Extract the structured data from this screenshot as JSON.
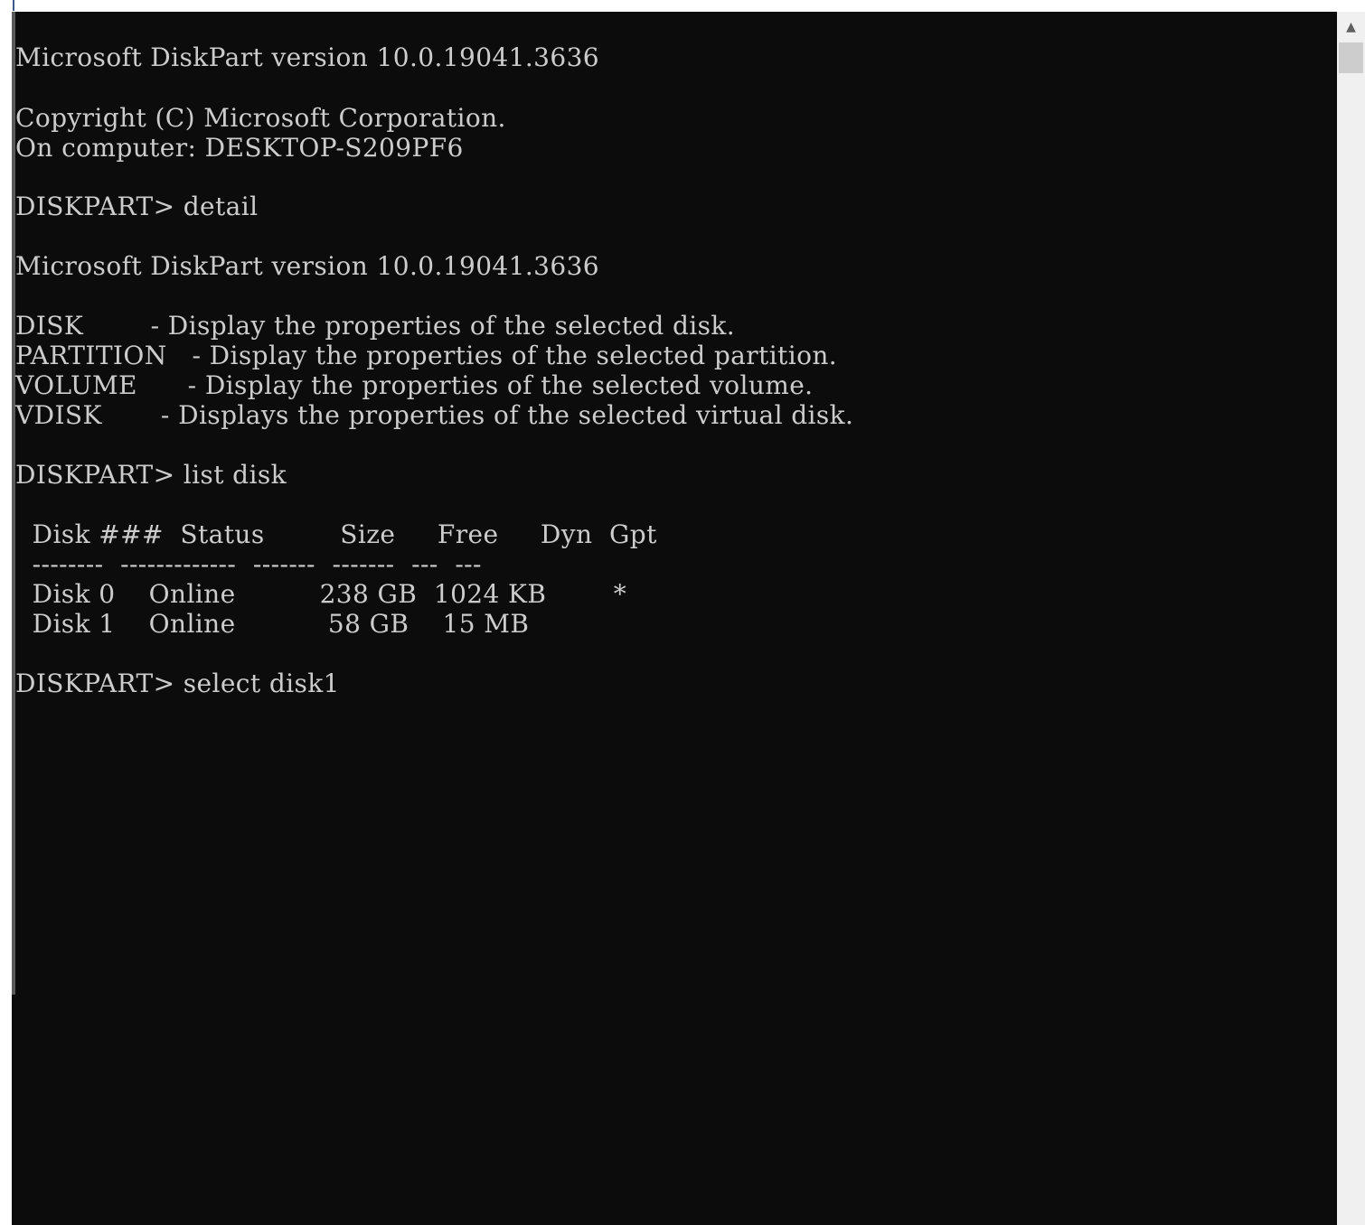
{
  "console": {
    "lines": [
      "Microsoft DiskPart version 10.0.19041.3636",
      "",
      "Copyright (C) Microsoft Corporation.",
      "On computer: DESKTOP-S209PF6",
      "",
      "DISKPART> detail",
      "",
      "Microsoft DiskPart version 10.0.19041.3636",
      "",
      "DISK        - Display the properties of the selected disk.",
      "PARTITION   - Display the properties of the selected partition.",
      "VOLUME      - Display the properties of the selected volume.",
      "VDISK       - Displays the properties of the selected virtual disk.",
      "",
      "DISKPART> list disk",
      "",
      "  Disk ###  Status         Size     Free     Dyn  Gpt",
      "  --------  -------------  -------  -------  ---  ---",
      "  Disk 0    Online          238 GB  1024 KB        *",
      "  Disk 1    Online           58 GB    15 MB",
      "",
      "DISKPART> select disk1"
    ]
  },
  "scrollbar": {
    "up_arrow": "▲"
  },
  "colors": {
    "console_bg": "#0c0c0c",
    "console_text": "#cccccc",
    "scrollbar_bg": "#f0f0f0",
    "scrollbar_thumb": "#cdcdcd"
  }
}
